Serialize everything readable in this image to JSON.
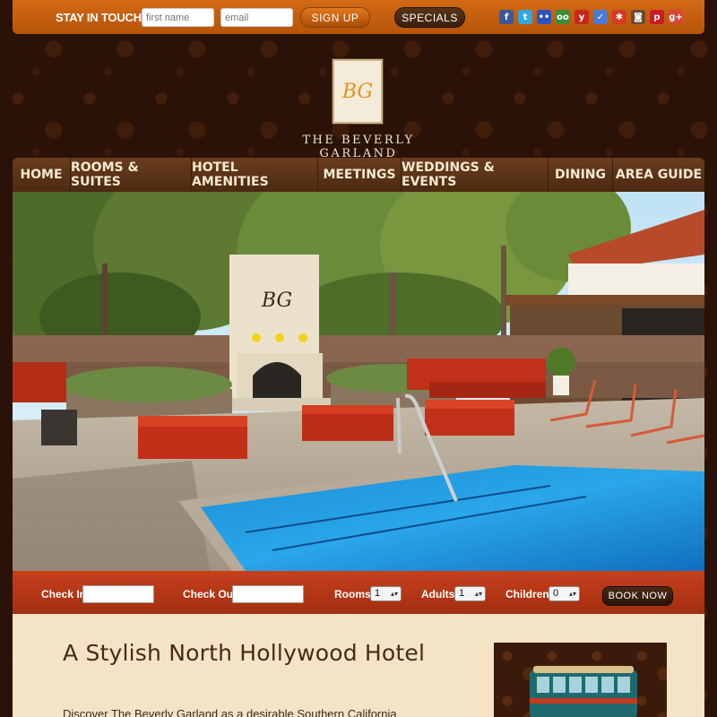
{
  "topbar": {
    "stay_label": "STAY IN TOUCH",
    "first_name_placeholder": "first name",
    "email_placeholder": "email",
    "signup_label": "SIGN UP",
    "specials_label": "SPECIALS",
    "social_icons": [
      {
        "name": "facebook-icon",
        "glyph": "f",
        "color": "#3b5998"
      },
      {
        "name": "twitter-icon",
        "glyph": "t",
        "color": "#2fa8e2"
      },
      {
        "name": "flickr-icon",
        "glyph": "••",
        "color": "#2b52c4"
      },
      {
        "name": "tripadvisor-icon",
        "glyph": "oo",
        "color": "#3a8f3a"
      },
      {
        "name": "yelp-icon",
        "glyph": "y",
        "color": "#c8261b"
      },
      {
        "name": "foursquare-icon",
        "glyph": "✓",
        "color": "#4b7ad8"
      },
      {
        "name": "yelp-alt-icon",
        "glyph": "✱",
        "color": "#d23a24"
      },
      {
        "name": "instagram-icon",
        "glyph": "◙",
        "color": "#6b4b36"
      },
      {
        "name": "pinterest-icon",
        "glyph": "p",
        "color": "#c81c24"
      },
      {
        "name": "google-plus-icon",
        "glyph": "g+",
        "color": "#d34836"
      }
    ]
  },
  "logo": {
    "monogram": "BG",
    "name": "THE BEVERLY GARLAND"
  },
  "nav": {
    "items": [
      "HOME",
      "ROOMS & SUITES",
      "HOTEL AMENITIES",
      "MEETINGS",
      "WEDDINGS & EVENTS",
      "DINING",
      "AREA GUIDE"
    ]
  },
  "hero": {
    "fireplace_monogram": "BG"
  },
  "booking": {
    "check_in_label": "Check In",
    "check_out_label": "Check Out",
    "rooms_label": "Rooms",
    "rooms_value": "1",
    "adults_label": "Adults",
    "adults_value": "1",
    "children_label": "Children",
    "children_value": "0",
    "book_label": "BOOK NOW"
  },
  "content": {
    "title": "A Stylish North Hollywood Hotel",
    "text": "Discover The Beverly Garland as a desirable Southern California"
  },
  "colors": {
    "topbar": "#c55f0e",
    "nav": "#5a3318",
    "booking": "#b6371a",
    "content_bg": "#f4e4c6",
    "title": "#4a2a14"
  }
}
